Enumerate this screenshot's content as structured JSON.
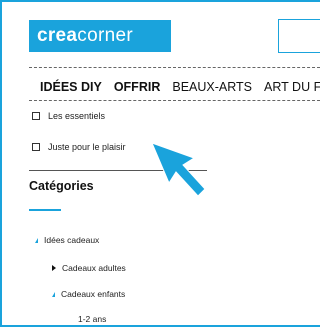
{
  "header": {
    "logo_bold": "crea",
    "logo_light": "corner"
  },
  "nav": {
    "items": [
      "IDÉES DIY",
      "OFFRIR",
      "BEAUX-ARTS",
      "ART DU FIL"
    ]
  },
  "filters": {
    "items": [
      "Les essentiels",
      "Juste pour le plaisir"
    ]
  },
  "sidebar": {
    "title": "Catégories",
    "tree": [
      {
        "label": "Idées cadeaux",
        "state": "expanded"
      },
      {
        "label": "Cadeaux adultes",
        "state": "collapsed"
      },
      {
        "label": "Cadeaux enfants",
        "state": "expanded"
      },
      {
        "label": "1-2 ans",
        "state": "leaf"
      }
    ]
  },
  "colors": {
    "accent": "#1aa3dc"
  },
  "icons": {
    "tree_expanded": "triangle-down-icon",
    "tree_collapsed": "triangle-right-icon",
    "pointer": "mouse-cursor-icon"
  }
}
